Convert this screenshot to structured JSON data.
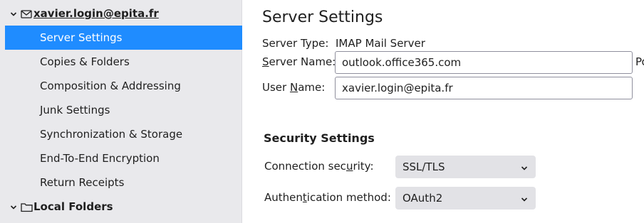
{
  "sidebar": {
    "account": {
      "name": "xavier.login@epita.fr",
      "icon": "mail-icon"
    },
    "items": [
      {
        "label": "Server Settings",
        "selected": true
      },
      {
        "label": "Copies & Folders"
      },
      {
        "label": "Composition & Addressing"
      },
      {
        "label": "Junk Settings"
      },
      {
        "label": "Synchronization & Storage"
      },
      {
        "label": "End-To-End Encryption"
      },
      {
        "label": "Return Receipts"
      }
    ],
    "local_folders": {
      "name": "Local Folders",
      "icon": "folder-icon"
    }
  },
  "main": {
    "title": "Server Settings",
    "server_type": {
      "label": "Server Type:",
      "value": "IMAP Mail Server"
    },
    "server_name": {
      "label_pre": "",
      "label_key": "S",
      "label_post": "erver Name:",
      "value": "outlook.office365.com"
    },
    "port_label_clip": "Po",
    "user_name": {
      "label_pre": "User ",
      "label_key": "N",
      "label_post": "ame:",
      "value": "xavier.login@epita.fr"
    },
    "security": {
      "title": "Security Settings",
      "connection": {
        "label_pre": "Connection sec",
        "label_key": "u",
        "label_post": "rity:",
        "value": "SSL/TLS"
      },
      "auth": {
        "label_pre": "Authen",
        "label_key": "t",
        "label_post": "ication method:",
        "value": "OAuth2"
      }
    }
  },
  "colors": {
    "selected_bg": "#1f8cff",
    "sidebar_bg": "#e9e9ec",
    "select_bg": "#e2e2e6"
  }
}
